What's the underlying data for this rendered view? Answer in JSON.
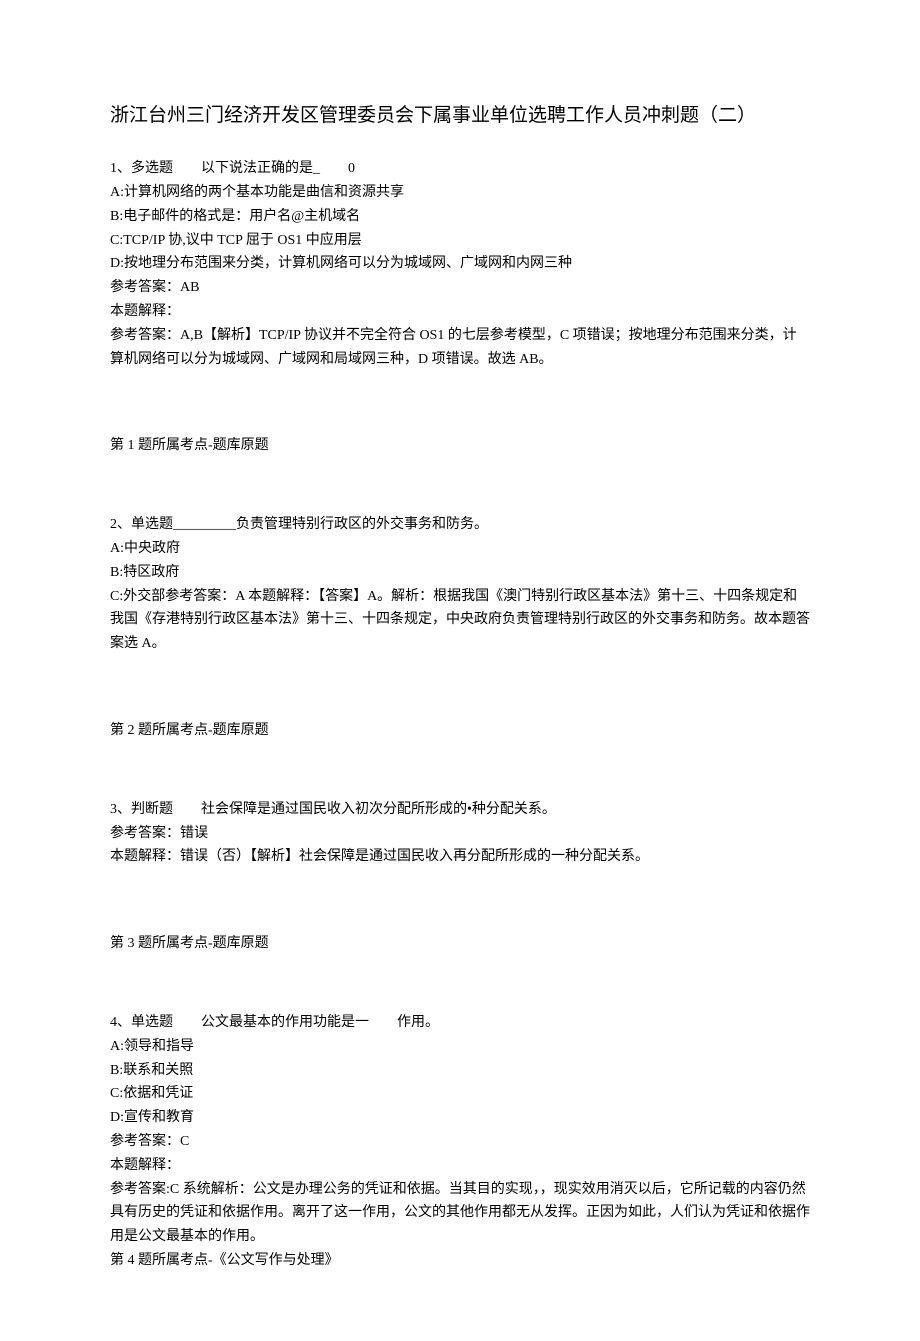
{
  "title": "浙江台州三门经济开发区管理委员会下属事业单位选聘工作人员冲刺题（二）",
  "q1": {
    "prompt": "1、多选题　　以下说法正确的是_　　0",
    "a": "A:计算机网络的两个基本功能是曲信和资源共享",
    "b": "B:电子邮件的格式是：用户名@主机域名",
    "c": "C:TCP/IP 协,议中 TCP 屈于 OS1 中应用层",
    "d": "D:按地理分布范围来分类，计算机网络可以分为城域网、广域网和内网三种",
    "ref": "参考答案：AB",
    "exp_label": "本题解释：",
    "exp": "参考答案：A,B【解析】TCP/IP 协议并不完全符合 OS1 的七层参考模型，C 项错误；按地理分布范围来分类，计算机网络可以分为城域网、广域网和局域网三种，D 项错误。故选 AB。",
    "topic": "第 1 题所属考点-题库原题"
  },
  "q2": {
    "prompt": "2、单选题_________负责管理特别行政区的外交事务和防务。",
    "a": "A:中央政府",
    "b": "B:特区政府",
    "c": "C:外交部参考答案：A 本题解释：【答案】A。解析：根据我国《澳门特别行政区基本法》第十三、十四条规定和我国《存港特别行政区基本法》第十三、十四条规定，中央政府负责管理特别行政区的外交事务和防务。故本题答案选 A。",
    "topic": "第 2 题所属考点-题库原题"
  },
  "q3": {
    "prompt": "3、判断题　　社会保障是通过国民收入初次分配所形成的•种分配关系。",
    "ref": "参考答案：错误",
    "exp": "本题解释：错误（否）【解析】社会保障是通过国民收入再分配所形成的一种分配关系。",
    "topic": "第 3 题所属考点-题库原题"
  },
  "q4": {
    "prompt": "4、单选题　　公文最基本的作用功能是一　　作用。",
    "a": "A:领导和指导",
    "b": "B:联系和关照",
    "c": "C:依据和凭证",
    "d": "D:宣传和教育",
    "ref": "参考答案：C",
    "exp_label": "本题解释：",
    "exp": "参考答案:C 系统解析：公文是办理公务的凭证和依据。当其目的实现，，现实效用消灭以后，它所记载的内容仍然具有历史的凭证和依据作用。离开了这一作用，公文的其他作用都无从发挥。正因为如此，人们认为凭证和依据作用是公文最基本的作用。",
    "topic": "第 4 题所属考点-《公文写作与处理》"
  }
}
